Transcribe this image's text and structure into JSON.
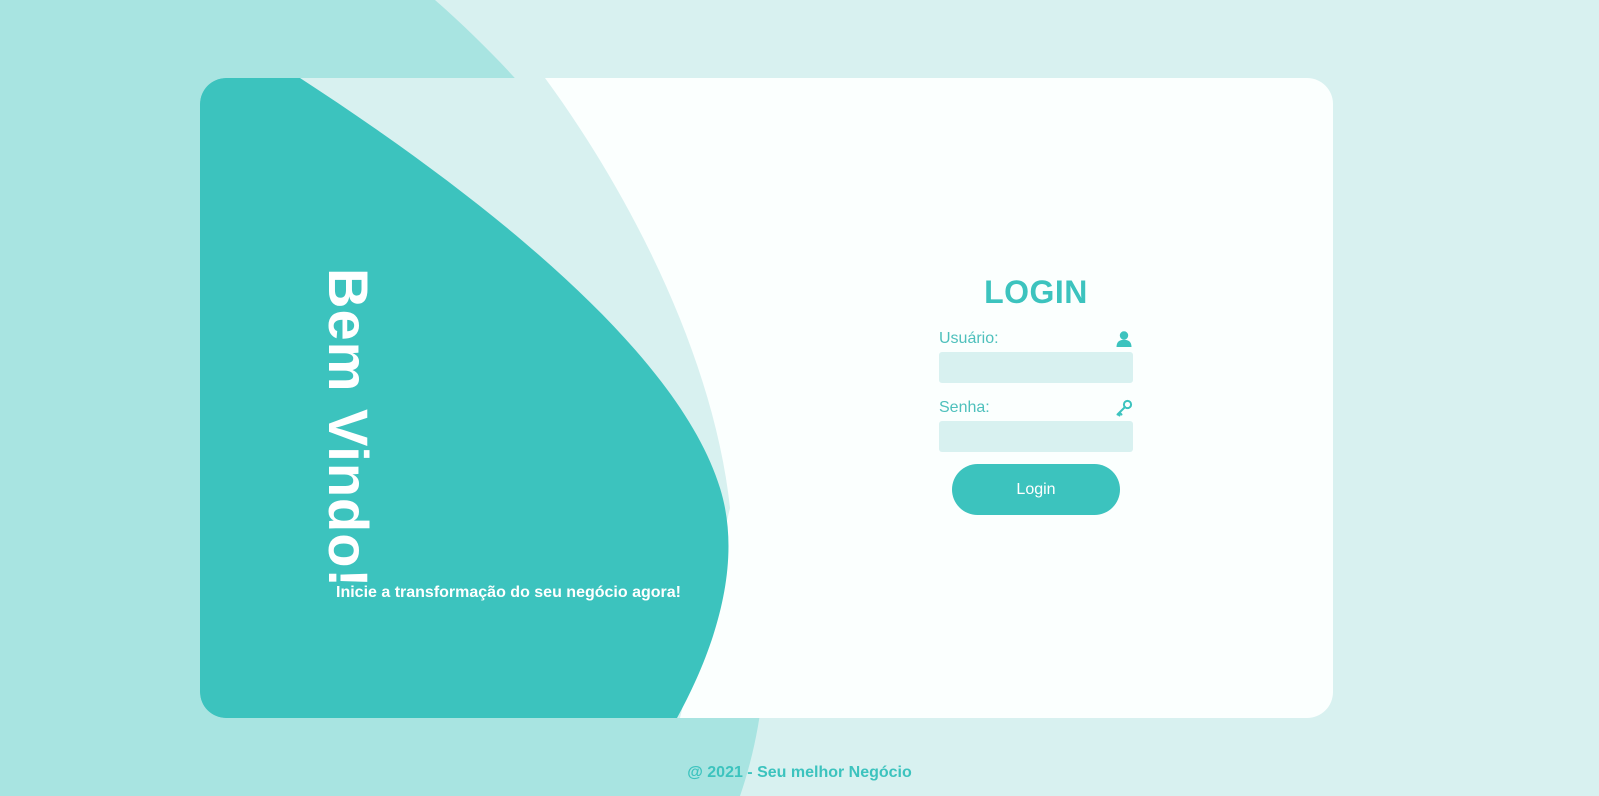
{
  "colors": {
    "accent": "#3cc3be",
    "background": "#d8f1f0",
    "background_wave": "#a8e4e1",
    "card": "#fbfffe",
    "text_on_accent": "#ffffff"
  },
  "welcome": {
    "title": "Bem Vindo!",
    "subtitle": "Inicie a transformação do seu negócio agora!"
  },
  "login": {
    "title": "LOGIN",
    "username_label": "Usuário:",
    "username_icon": "user-icon",
    "username_value": "",
    "password_label": "Senha:",
    "password_icon": "key-icon",
    "password_value": "",
    "button_label": "Login"
  },
  "footer": {
    "text": "@ 2021 - Seu melhor Negócio"
  }
}
